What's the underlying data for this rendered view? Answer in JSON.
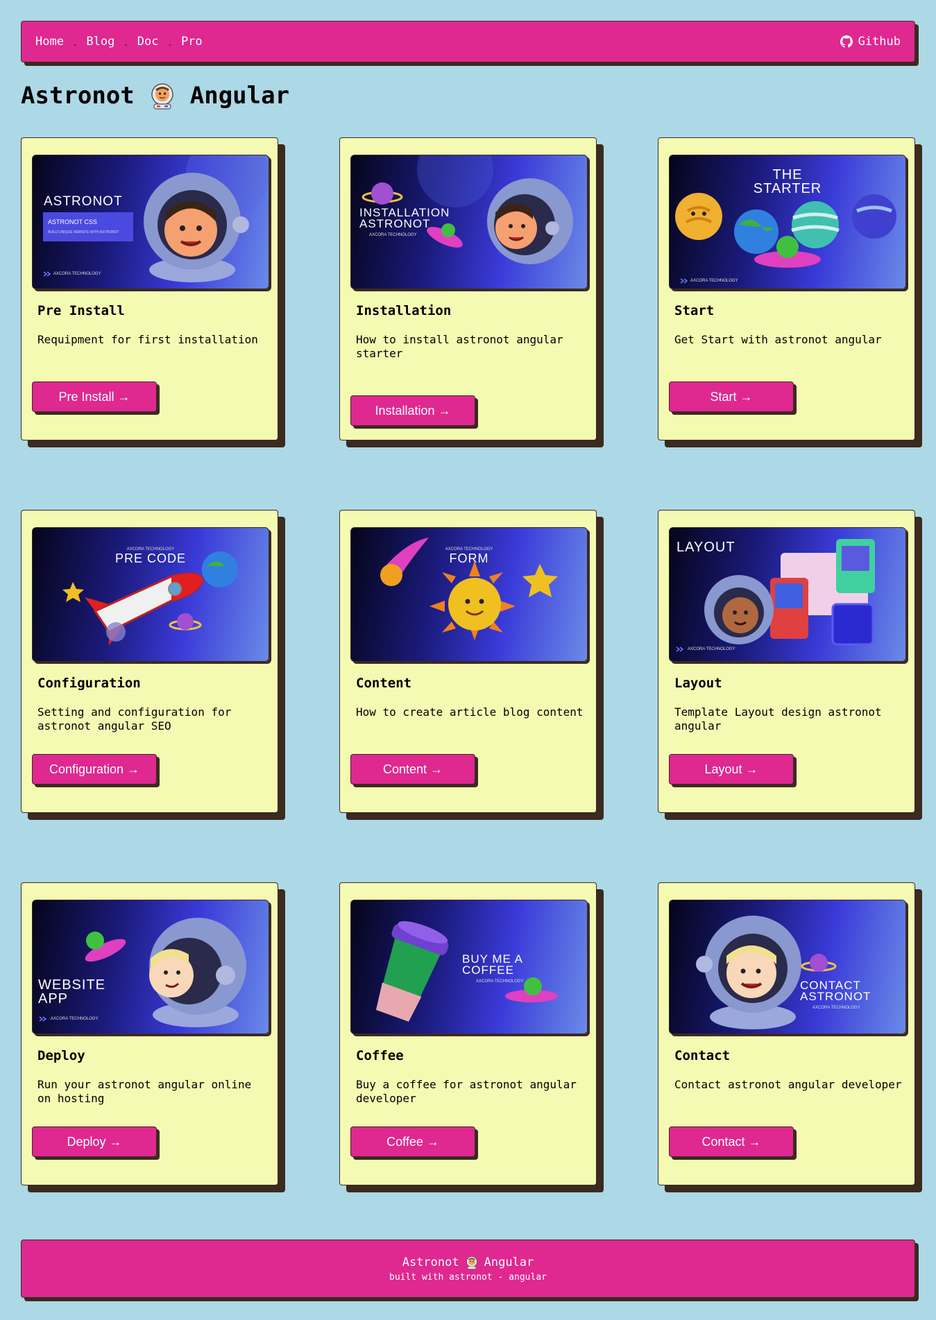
{
  "nav": {
    "links": [
      "Home",
      "Blog",
      "Doc",
      "Pro"
    ],
    "separator": ".",
    "github_label": "Github",
    "github_icon": "github-icon"
  },
  "page": {
    "title_left": "Astronot",
    "title_right": "Angular",
    "title_icon": "astronaut-icon"
  },
  "colors": {
    "background": "#add8e6",
    "accent": "#df2890",
    "card": "#f5fab3",
    "shadow": "#3a2a20"
  },
  "cards": [
    {
      "title": "Pre Install",
      "description": "Requipment for first installation",
      "button": "Pre Install →",
      "image_text": [
        "ASTRONOT",
        "ASTRONOT CSS",
        "BUILD UNIQUE WEBSITE WITH ASTRONOT",
        "AXCORA TECHNOLOGY"
      ]
    },
    {
      "title": "Installation",
      "description": "How to install astronot angular starter",
      "button": "Installation →",
      "image_text": [
        "INSTALLATION",
        "ASTRONOT",
        "AXCORA TECHNOLOGY"
      ]
    },
    {
      "title": "Start",
      "description": "Get Start with astronot angular",
      "button": "Start →",
      "image_text": [
        "THE",
        "STARTER",
        "AXCORA TECHNOLOGY"
      ]
    },
    {
      "title": "Configuration",
      "description": "Setting and configuration for astronot angular SEO",
      "button": "Configuration →",
      "image_text": [
        "AXCORA TECHNOLOGY",
        "PRE CODE"
      ]
    },
    {
      "title": "Content",
      "description": "How to create article blog content",
      "button": "Content →",
      "image_text": [
        "AXCORA TECHNOLOGY",
        "FORM"
      ]
    },
    {
      "title": "Layout",
      "description": "Template Layout design astronot angular",
      "button": "Layout →",
      "image_text": [
        "LAYOUT",
        "AXCORA TECHNOLOGY"
      ]
    },
    {
      "title": "Deploy",
      "description": "Run your astronot angular online on hosting",
      "button": "Deploy →",
      "image_text": [
        "WEBSITE",
        "APP",
        "AXCORA TECHNOLOGY"
      ]
    },
    {
      "title": "Coffee",
      "description": "Buy a coffee for astronot angular developer",
      "button": "Coffee →",
      "image_text": [
        "BUY ME A",
        "COFFEE",
        "AXCORA TECHNOLOGY"
      ]
    },
    {
      "title": "Contact",
      "description": "Contact astronot angular developer",
      "button": "Contact →",
      "image_text": [
        "CONTACT",
        "ASTRONOT",
        "AXCORA TECHNOLOGY"
      ]
    }
  ],
  "footer": {
    "title_left": "Astronot",
    "title_right": "Angular",
    "subtitle": "built with astronot - angular"
  }
}
